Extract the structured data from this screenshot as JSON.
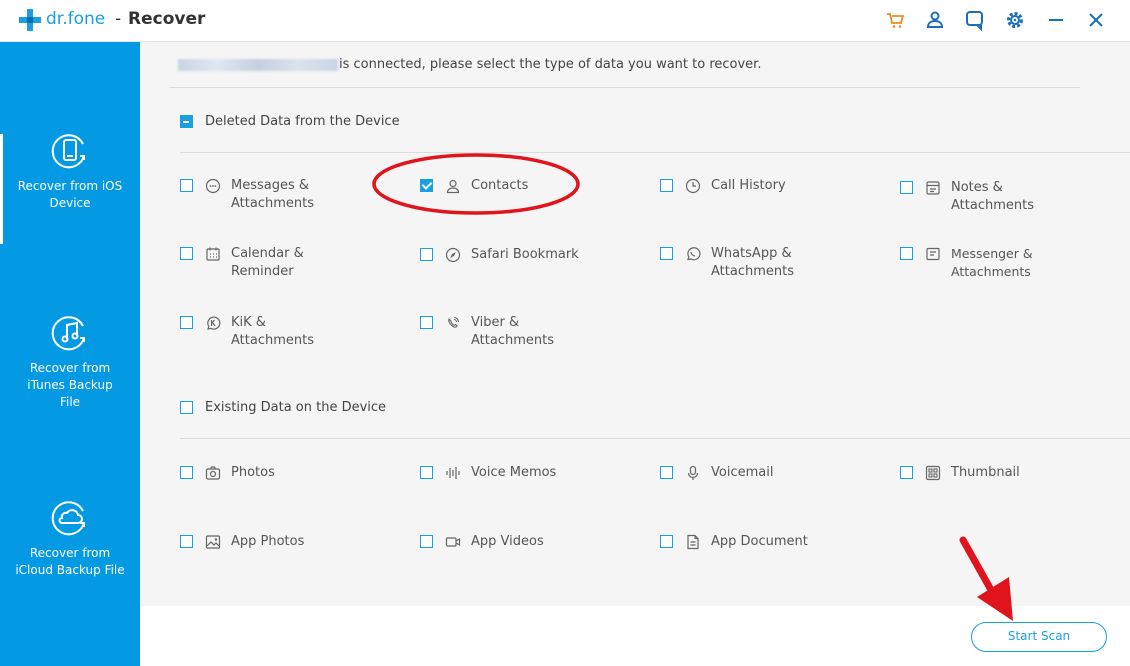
{
  "app": {
    "brand": "dr.fone",
    "separator": "-",
    "title": "Recover"
  },
  "titlebar_icons": [
    "cart-icon",
    "account-icon",
    "feedback-icon",
    "settings-icon",
    "minimize-icon",
    "close-icon"
  ],
  "sidebar": {
    "items": [
      {
        "label_line1": "Recover from iOS",
        "label_line2": "Device",
        "icon": "phone-recover-icon",
        "active": true
      },
      {
        "label_line1": "Recover from",
        "label_line2": "iTunes Backup",
        "label_line3": "File",
        "icon": "music-recover-icon"
      },
      {
        "label_line1": "Recover from",
        "label_line2": "iCloud Backup File",
        "icon": "cloud-recover-icon"
      }
    ]
  },
  "main": {
    "connected_text": "is connected, please select the type of data you want to recover.",
    "section_deleted": {
      "label": "Deleted Data from the Device",
      "state": "partial",
      "items": [
        {
          "line1": "Messages &",
          "line2": "Attachments",
          "icon": "message-icon",
          "checked": false
        },
        {
          "line1": "Contacts",
          "line2": "",
          "icon": "contact-icon",
          "checked": true
        },
        {
          "line1": "Call History",
          "line2": "",
          "icon": "clock-icon",
          "checked": false
        },
        {
          "line1": "Notes &",
          "line2": "Attachments",
          "icon": "notes-icon",
          "checked": false
        },
        {
          "line1": "Calendar &",
          "line2": "Reminder",
          "icon": "calendar-icon",
          "checked": false
        },
        {
          "line1": "Safari Bookmark",
          "line2": "",
          "icon": "compass-icon",
          "checked": false
        },
        {
          "line1": "WhatsApp &",
          "line2": "Attachments",
          "icon": "whatsapp-icon",
          "checked": false
        },
        {
          "line1": "Messenger &",
          "line2": "Attachments",
          "icon": "messenger-icon",
          "checked": false
        },
        {
          "line1": "KiK &",
          "line2": "Attachments",
          "icon": "kik-icon",
          "checked": false
        },
        {
          "line1": "Viber &",
          "line2": "Attachments",
          "icon": "viber-icon",
          "checked": false
        }
      ]
    },
    "section_existing": {
      "label": "Existing Data on the Device",
      "state": "unchecked",
      "items": [
        {
          "line1": "Photos",
          "icon": "camera-icon",
          "checked": false
        },
        {
          "line1": "Voice Memos",
          "icon": "waveform-icon",
          "checked": false
        },
        {
          "line1": "Voicemail",
          "icon": "microphone-icon",
          "checked": false
        },
        {
          "line1": "Thumbnail",
          "icon": "thumbnail-icon",
          "checked": false
        },
        {
          "line1": "App Photos",
          "icon": "image-icon",
          "checked": false
        },
        {
          "line1": "App Videos",
          "icon": "video-icon",
          "checked": false
        },
        {
          "line1": "App Document",
          "icon": "document-icon",
          "checked": false
        }
      ]
    }
  },
  "footer": {
    "start_scan_label": "Start Scan"
  },
  "colors": {
    "accent": "#1a9fe0",
    "sidebar_bg": "#049ae3",
    "annotation_red": "#e0141c"
  }
}
